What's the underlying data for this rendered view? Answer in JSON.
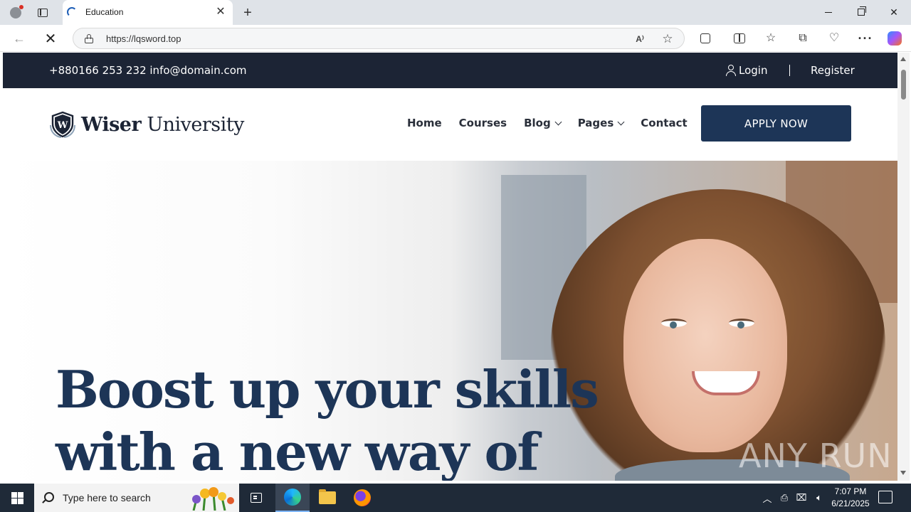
{
  "browser": {
    "tab": {
      "title": "Education"
    },
    "address": {
      "url": "https://lqsword.top"
    }
  },
  "site": {
    "topbar": {
      "contact": "+880166 253 232 info@domain.com",
      "login": "Login",
      "register": "Register"
    },
    "logo": {
      "bold": "Wiser",
      "light": "University"
    },
    "nav": [
      {
        "label": "Home"
      },
      {
        "label": "Courses"
      },
      {
        "label": "Blog"
      },
      {
        "label": "Pages"
      },
      {
        "label": "Contact"
      }
    ],
    "cta": "APPLY NOW",
    "hero": {
      "line1": "Boost up your skills",
      "line2": "with a new way of"
    },
    "watermark": "ANY RUN"
  },
  "taskbar": {
    "search_placeholder": "Type here to search",
    "time": "7:07 PM",
    "date": "6/21/2025"
  },
  "colors": {
    "topbar_bg": "#1c2435",
    "brand_navy": "#1d3557",
    "taskbar_bg": "#1f2a38"
  },
  "icons": {
    "profile": "profile-icon",
    "tab_actions": "tab-actions-icon",
    "stop": "stop-loading-icon",
    "lock": "lock-icon",
    "user": "user-icon",
    "logo": "shield-logo-icon"
  }
}
